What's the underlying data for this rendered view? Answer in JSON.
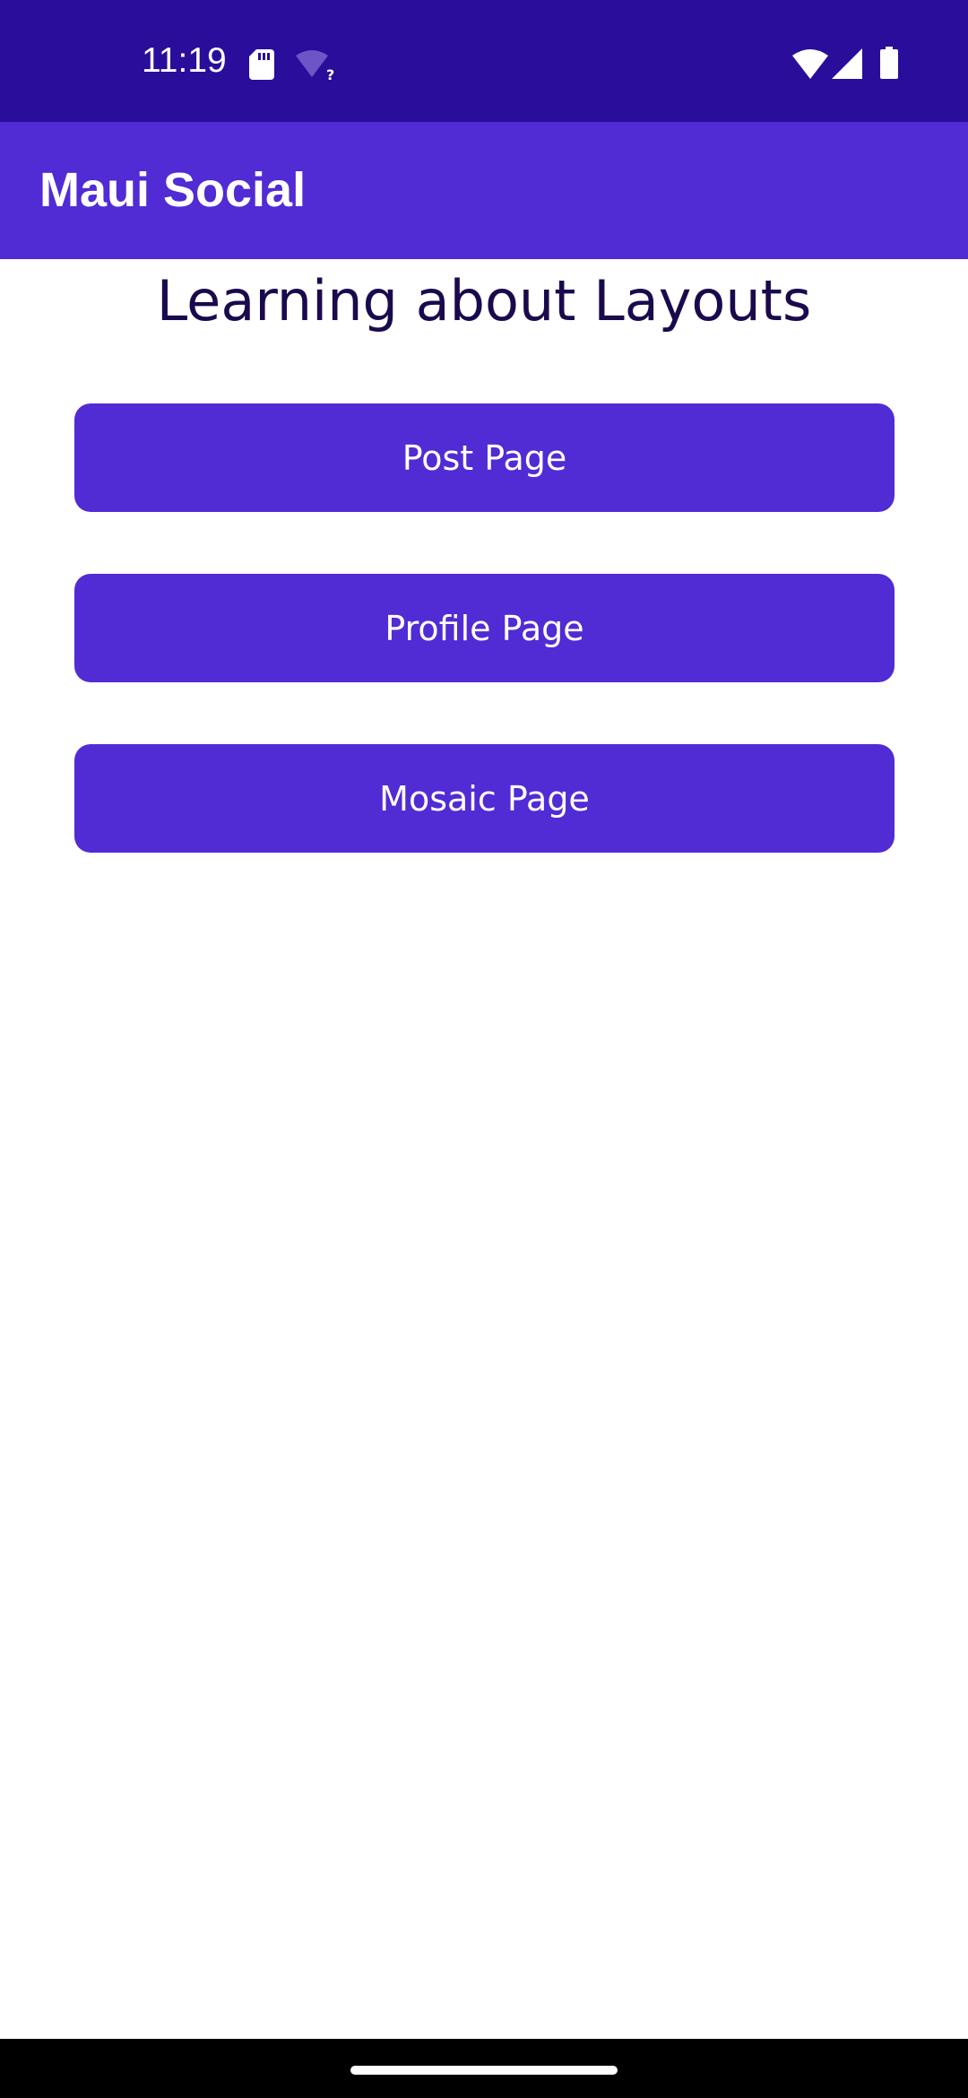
{
  "status_bar": {
    "time": "11:19",
    "icons": [
      "sd-card-icon",
      "wifi-unknown-icon",
      "wifi-icon",
      "cellular-signal-icon",
      "battery-icon"
    ],
    "background": "#2a0d9a"
  },
  "app_bar": {
    "title": "Maui Social",
    "background": "#512bd4"
  },
  "main": {
    "heading": "Learning about Layouts",
    "buttons": [
      {
        "label": "Post Page"
      },
      {
        "label": "Profile Page"
      },
      {
        "label": "Mosaic Page"
      }
    ],
    "button_color": "#512bd4",
    "heading_color": "#1a0a4d"
  },
  "nav_bar": {
    "background": "#000000"
  }
}
